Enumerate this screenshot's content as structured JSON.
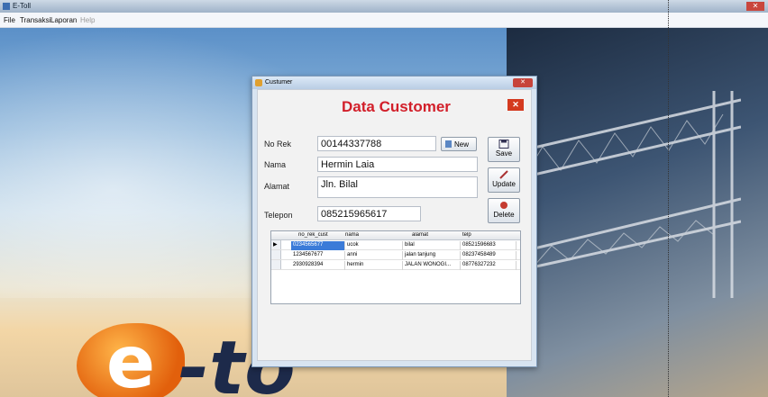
{
  "window": {
    "title": "E-Toll"
  },
  "menu": {
    "items": [
      "File",
      "Transaksi",
      "Laporan",
      "Help"
    ]
  },
  "dialog": {
    "title": "Custumer",
    "header": "Data Customer",
    "form": {
      "no_rek_label": "No Rek",
      "no_rek_value": "00144337788",
      "nama_label": "Nama",
      "nama_value": "Hermin Laia",
      "alamat_label": "Alamat",
      "alamat_value": "Jln. Bilal",
      "telepon_label": "Telepon",
      "telepon_value": "085215965617"
    },
    "buttons": {
      "new": "New",
      "save": "Save",
      "update": "Update",
      "delete": "Delete"
    },
    "grid": {
      "columns": [
        "no_rek_cust",
        "nama",
        "alamat",
        "telp"
      ],
      "rows": [
        [
          "0234565677",
          "ucok",
          "bilal",
          "08521596683"
        ],
        [
          "1234567677",
          "anni",
          "jalan tanjung",
          "08237458489"
        ],
        [
          "2930928394",
          "hermin",
          "JALAN WONOGI...",
          "08776327232"
        ]
      ]
    }
  },
  "logo": {
    "e": "e",
    "text": "-to"
  }
}
